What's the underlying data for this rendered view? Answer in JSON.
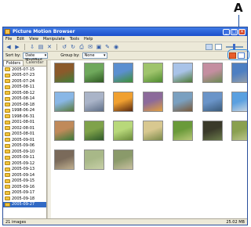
{
  "callout": {
    "letter": "A"
  },
  "window": {
    "title": "Picture Motion Browser"
  },
  "menu": [
    "File",
    "Edit",
    "View",
    "Manipulate",
    "Tools",
    "Help"
  ],
  "toolbar": {
    "icons": [
      "back-icon",
      "forward-icon",
      "import-icon",
      "folder-icon",
      "delete-icon",
      "rotate-left-icon",
      "rotate-right-icon",
      "print-icon",
      "email-icon",
      "slideshow-icon",
      "edit-icon",
      "burn-icon"
    ],
    "view_icons": [
      "thumbnail-view-icon",
      "list-view-icon"
    ]
  },
  "options": {
    "sort_label": "Sort by:",
    "sort_value": "Date Modified",
    "group_label": "Group by:",
    "group_value": "None"
  },
  "left_pane": {
    "tabs": [
      "Folders",
      "Calendar"
    ],
    "folders": [
      {
        "name": "2005-07-15"
      },
      {
        "name": "2005-07-23"
      },
      {
        "name": "2005-07-24"
      },
      {
        "name": "2005-08-11"
      },
      {
        "name": "2005-08-12"
      },
      {
        "name": "2005-08-14"
      },
      {
        "name": "2005-08-18"
      },
      {
        "name": "1998-06-24"
      },
      {
        "name": "1998-06-31"
      },
      {
        "name": "2001-08-01"
      },
      {
        "name": "2002-08-01"
      },
      {
        "name": "2003-08-01"
      },
      {
        "name": "2005-09-01"
      },
      {
        "name": "2005-09-06"
      },
      {
        "name": "2005-09-10"
      },
      {
        "name": "2005-09-11"
      },
      {
        "name": "2005-09-12"
      },
      {
        "name": "2005-09-13"
      },
      {
        "name": "2005-09-14"
      },
      {
        "name": "2005-09-15"
      },
      {
        "name": "2005-09-16"
      },
      {
        "name": "2005-09-17"
      },
      {
        "name": "2005-09-18"
      },
      {
        "name": "2005-09-27",
        "selected": true
      }
    ]
  },
  "thumbnails": [
    {
      "c1": "#8b5a2b",
      "c2": "#3f7f3a"
    },
    {
      "c1": "#6fa85c",
      "c2": "#2f5a22"
    },
    {
      "c1": "#5b8fd0",
      "c2": "#3f8f35"
    },
    {
      "c1": "#9fc46c",
      "c2": "#4d8a2e"
    },
    {
      "c1": "#a9c3e8",
      "c2": "#4f7a36"
    },
    {
      "c1": "#c48ea0",
      "c2": "#6a8a52"
    },
    {
      "c1": "#4d7fc2",
      "c2": "#9aa0a8"
    },
    {
      "c1": "#89b7e6",
      "c2": "#5a7a3c"
    },
    {
      "c1": "#aab4c8",
      "c2": "#5f6f88"
    },
    {
      "c1": "#f0a030",
      "c2": "#5a2a10"
    },
    {
      "c1": "#8c6a9a",
      "c2": "#e0a040"
    },
    {
      "c1": "#7aa0c0",
      "c2": "#7a5a3a"
    },
    {
      "c1": "#6a94c8",
      "c2": "#3a5a78"
    },
    {
      "c1": "#5aa0e0",
      "c2": "#d0d8e0"
    },
    {
      "c1": "#c08a5a",
      "c2": "#3a7a3a"
    },
    {
      "c1": "#7fa24a",
      "c2": "#2f5a2a"
    },
    {
      "c1": "#b8d87a",
      "c2": "#6a8a3a"
    },
    {
      "c1": "#d8c890",
      "c2": "#7a8a4a"
    },
    {
      "c1": "#6a9a3a",
      "c2": "#b8c878"
    },
    {
      "c1": "#3a3a2a",
      "c2": "#6a7a4a"
    },
    {
      "c1": "#8aa050",
      "c2": "#c0c890"
    },
    {
      "c1": "#7a6a5a",
      "c2": "#c0b090"
    },
    {
      "c1": "#a8b888",
      "c2": "#c8d0a8"
    },
    {
      "c1": "#8a9a6a",
      "c2": "#c8c0a0"
    }
  ],
  "status": {
    "left": "21 images",
    "right": "25.02 MB"
  }
}
